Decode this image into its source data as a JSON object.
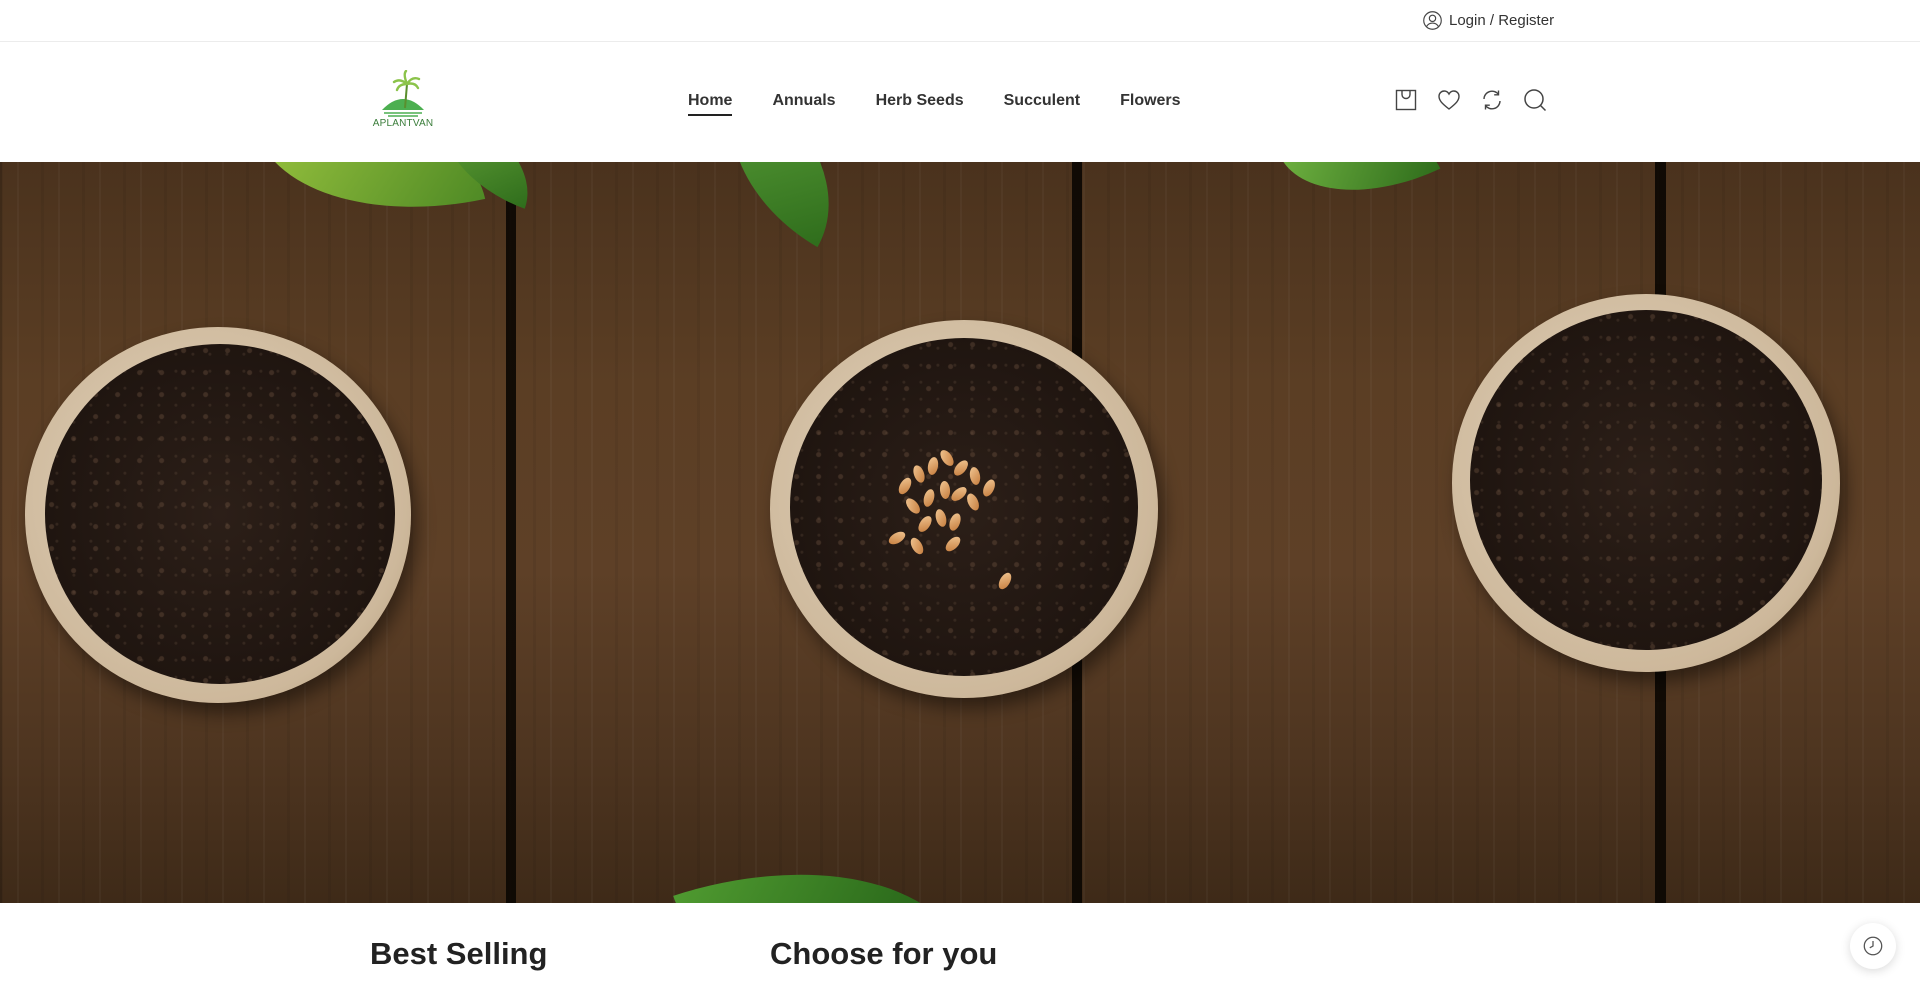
{
  "topbar": {
    "login_label": "Login / Register",
    "login_icon": "user-circle-icon"
  },
  "header": {
    "logo_text": "APLANTVAN",
    "nav": [
      {
        "label": "Home",
        "active": true
      },
      {
        "label": "Annuals",
        "active": false
      },
      {
        "label": "Herb Seeds",
        "active": false
      },
      {
        "label": "Succulent",
        "active": false
      },
      {
        "label": "Flowers",
        "active": false
      }
    ],
    "icons": [
      "cart-icon",
      "heart-icon",
      "refresh-icon",
      "search-icon"
    ]
  },
  "hero": {
    "image": "seed-pots-on-wood-photo"
  },
  "sections": {
    "best_selling": "Best Selling",
    "choose_for_you": "Choose for you"
  },
  "floating": {
    "history_icon": "clock-history-icon"
  },
  "colors": {
    "accent": "#222222",
    "logo_green": "#3a7d3a"
  }
}
